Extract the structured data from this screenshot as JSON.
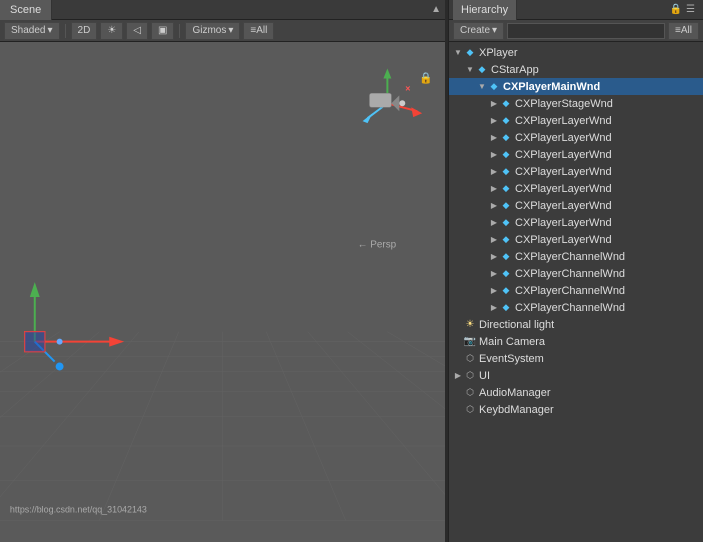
{
  "scene": {
    "tab_label": "Scene",
    "shading_mode": "Shaded",
    "view_2d": "2D",
    "gizmos_btn": "Gizmos",
    "all_btn": "≡All",
    "persp_label": "← Persp",
    "lock_icon": "🔒",
    "watermark": "https://blog.csdn.net/qq_31042143"
  },
  "hierarchy": {
    "tab_label": "Hierarchy",
    "create_btn": "Create",
    "all_btn": "≡All",
    "search_placeholder": "",
    "items": [
      {
        "id": "xplayer",
        "label": "XPlayer",
        "indent": 0,
        "arrow": "open",
        "icon": "prefab",
        "selected": false
      },
      {
        "id": "cstarapp",
        "label": "CStarApp",
        "indent": 1,
        "arrow": "open",
        "icon": "prefab",
        "selected": false
      },
      {
        "id": "cplayermainwnd",
        "label": "CXPlayerMainWnd",
        "indent": 2,
        "arrow": "open",
        "icon": "prefab",
        "selected": true
      },
      {
        "id": "cplayerstagewnd",
        "label": "CXPlayerStageWnd",
        "indent": 3,
        "arrow": "closed",
        "icon": "prefab",
        "selected": false
      },
      {
        "id": "cplayerlayerwnd1",
        "label": "CXPlayerLayerWnd",
        "indent": 3,
        "arrow": "closed",
        "icon": "prefab",
        "selected": false
      },
      {
        "id": "cplayerlayerwnd2",
        "label": "CXPlayerLayerWnd",
        "indent": 3,
        "arrow": "closed",
        "icon": "prefab",
        "selected": false
      },
      {
        "id": "cplayerlayerwnd3",
        "label": "CXPlayerLayerWnd",
        "indent": 3,
        "arrow": "closed",
        "icon": "prefab",
        "selected": false
      },
      {
        "id": "cplayerlayerwnd4",
        "label": "CXPlayerLayerWnd",
        "indent": 3,
        "arrow": "closed",
        "icon": "prefab",
        "selected": false
      },
      {
        "id": "cplayerlayerwnd5",
        "label": "CXPlayerLayerWnd",
        "indent": 3,
        "arrow": "closed",
        "icon": "prefab",
        "selected": false
      },
      {
        "id": "cplayerlayerwnd6",
        "label": "CXPlayerLayerWnd",
        "indent": 3,
        "arrow": "closed",
        "icon": "prefab",
        "selected": false
      },
      {
        "id": "cplayerlayerwnd7",
        "label": "CXPlayerLayerWnd",
        "indent": 3,
        "arrow": "closed",
        "icon": "prefab",
        "selected": false
      },
      {
        "id": "cplayerlayerwnd8",
        "label": "CXPlayerLayerWnd",
        "indent": 3,
        "arrow": "closed",
        "icon": "prefab",
        "selected": false
      },
      {
        "id": "cplayerchannelwnd1",
        "label": "CXPlayerChannelWnd",
        "indent": 3,
        "arrow": "closed",
        "icon": "prefab",
        "selected": false
      },
      {
        "id": "cplayerchannelwnd2",
        "label": "CXPlayerChannelWnd",
        "indent": 3,
        "arrow": "closed",
        "icon": "prefab",
        "selected": false
      },
      {
        "id": "cplayerchannelwnd3",
        "label": "CXPlayerChannelWnd",
        "indent": 3,
        "arrow": "closed",
        "icon": "prefab",
        "selected": false
      },
      {
        "id": "cplayerchannelwnd4",
        "label": "CXPlayerChannelWnd",
        "indent": 3,
        "arrow": "closed",
        "icon": "prefab",
        "selected": false
      },
      {
        "id": "directionallight",
        "label": "Directional light",
        "indent": 0,
        "arrow": "empty",
        "icon": "light",
        "selected": false
      },
      {
        "id": "maincamera",
        "label": "Main Camera",
        "indent": 0,
        "arrow": "empty",
        "icon": "camera",
        "selected": false
      },
      {
        "id": "eventsystem",
        "label": "EventSystem",
        "indent": 0,
        "arrow": "empty",
        "icon": "obj",
        "selected": false
      },
      {
        "id": "ui",
        "label": "UI",
        "indent": 0,
        "arrow": "closed",
        "icon": "obj",
        "selected": false
      },
      {
        "id": "audiomanager",
        "label": "AudioManager",
        "indent": 0,
        "arrow": "empty",
        "icon": "obj",
        "selected": false
      },
      {
        "id": "keybdmanager",
        "label": "KeybdManager",
        "indent": 0,
        "arrow": "empty",
        "icon": "obj",
        "selected": false
      }
    ]
  }
}
